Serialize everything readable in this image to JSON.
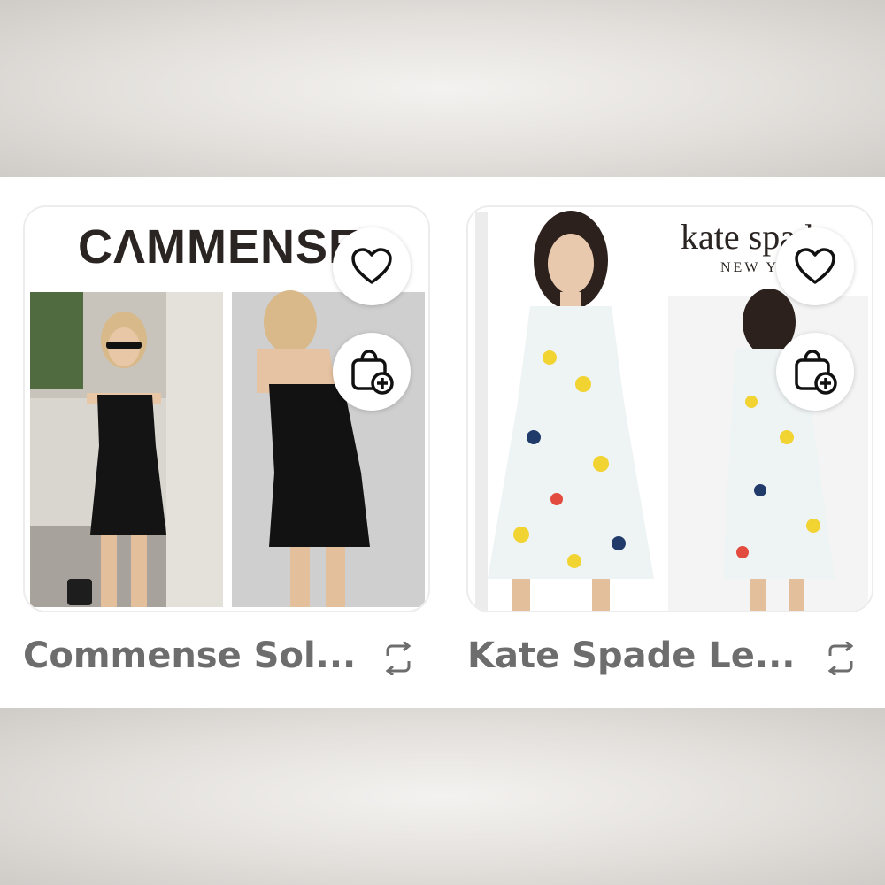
{
  "listings": [
    {
      "brand_logo_text": "CɅMMENSE",
      "title": "Commense Sol...",
      "favorite_icon": "heart-icon",
      "bag_icon": "add-to-bag-icon",
      "share_icon": "repost-icon"
    },
    {
      "brand_logo_text": "kate spade",
      "brand_logo_subtext": "NEW YORK",
      "title": "Kate Spade Le...",
      "favorite_icon": "heart-icon",
      "bag_icon": "add-to-bag-icon",
      "share_icon": "repost-icon"
    }
  ],
  "colors": {
    "title_gray": "#6d6d6d",
    "card_border": "#ececec",
    "icon_black": "#111111"
  }
}
